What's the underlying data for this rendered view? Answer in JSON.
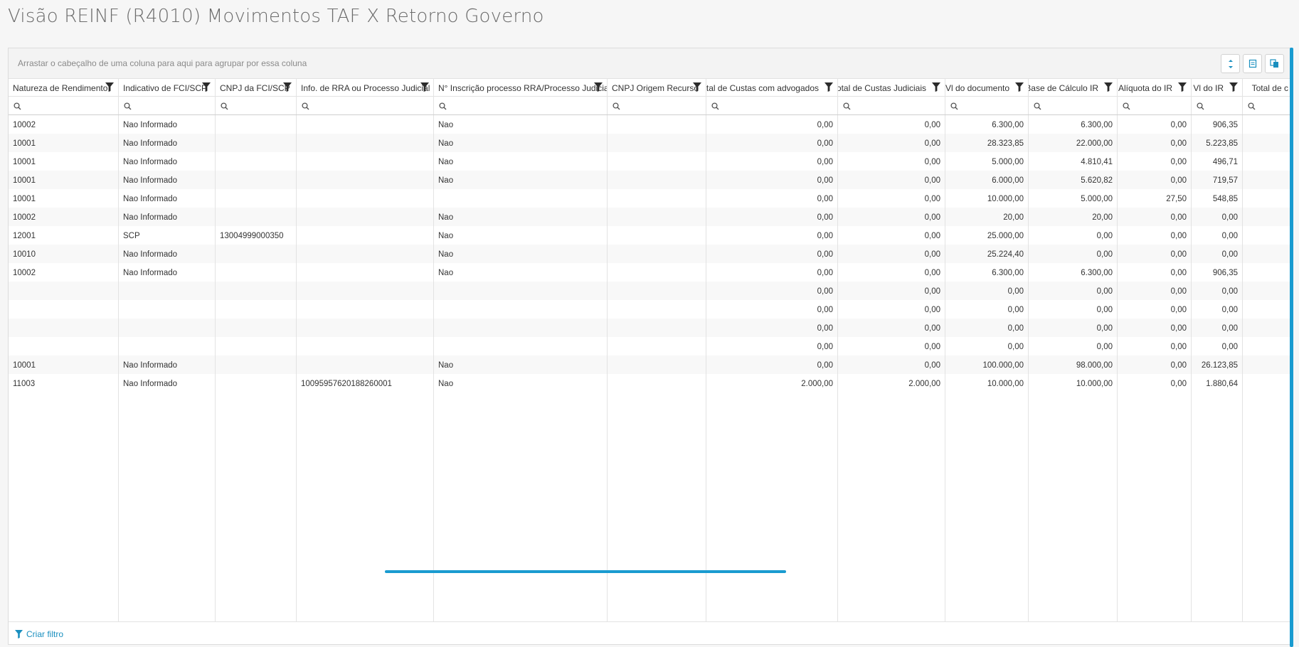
{
  "page": {
    "title": "Visão REINF (R4010) Movimentos TAF X Retorno Governo"
  },
  "groupbar": {
    "text": "Arrastar o cabeçalho de uma coluna para aqui para agrupar por essa coluna"
  },
  "toolbar": {
    "buttons": [
      {
        "icon": "column-chooser-icon"
      },
      {
        "icon": "export-icon"
      },
      {
        "icon": "copy-icon"
      }
    ]
  },
  "columns": [
    {
      "label": "Natureza de Rendimento",
      "align": "left"
    },
    {
      "label": "Indicativo de FCI/SCP",
      "align": "left"
    },
    {
      "label": "CNPJ da FCI/SCP",
      "align": "left"
    },
    {
      "label": "Info. de RRA ou Processo Judicial",
      "align": "left"
    },
    {
      "label": "N° Inscrição processo RRA/Processo Judicial",
      "align": "left"
    },
    {
      "label": "CNPJ Origem Recurso",
      "align": "left"
    },
    {
      "label": "Total de Custas com advogados",
      "align": "right"
    },
    {
      "label": "Total de Custas Judiciais",
      "align": "right"
    },
    {
      "label": "Vl do documento",
      "align": "right"
    },
    {
      "label": "Base de Cálculo IR",
      "align": "right"
    },
    {
      "label": "Alíquota do IR",
      "align": "right"
    },
    {
      "label": "Vl do IR",
      "align": "right"
    },
    {
      "label": "Total de c",
      "align": "right"
    }
  ],
  "rows": [
    [
      "10002",
      "Nao Informado",
      "",
      "",
      "Nao",
      "",
      "0,00",
      "0,00",
      "6.300,00",
      "6.300,00",
      "0,00",
      "906,35",
      ""
    ],
    [
      "10001",
      "Nao Informado",
      "",
      "",
      "Nao",
      "",
      "0,00",
      "0,00",
      "28.323,85",
      "22.000,00",
      "0,00",
      "5.223,85",
      ""
    ],
    [
      "10001",
      "Nao Informado",
      "",
      "",
      "Nao",
      "",
      "0,00",
      "0,00",
      "5.000,00",
      "4.810,41",
      "0,00",
      "496,71",
      ""
    ],
    [
      "10001",
      "Nao Informado",
      "",
      "",
      "Nao",
      "",
      "0,00",
      "0,00",
      "6.000,00",
      "5.620,82",
      "0,00",
      "719,57",
      ""
    ],
    [
      "10001",
      "Nao Informado",
      "",
      "",
      "",
      "",
      "0,00",
      "0,00",
      "10.000,00",
      "5.000,00",
      "27,50",
      "548,85",
      ""
    ],
    [
      "10002",
      "Nao Informado",
      "",
      "",
      "Nao",
      "",
      "0,00",
      "0,00",
      "20,00",
      "20,00",
      "0,00",
      "0,00",
      ""
    ],
    [
      "12001",
      "SCP",
      "13004999000350",
      "",
      "Nao",
      "",
      "0,00",
      "0,00",
      "25.000,00",
      "0,00",
      "0,00",
      "0,00",
      ""
    ],
    [
      "10010",
      "Nao Informado",
      "",
      "",
      "Nao",
      "",
      "0,00",
      "0,00",
      "25.224,40",
      "0,00",
      "0,00",
      "0,00",
      ""
    ],
    [
      "10002",
      "Nao Informado",
      "",
      "",
      "Nao",
      "",
      "0,00",
      "0,00",
      "6.300,00",
      "6.300,00",
      "0,00",
      "906,35",
      ""
    ],
    [
      "",
      "",
      "",
      "",
      "",
      "",
      "0,00",
      "0,00",
      "0,00",
      "0,00",
      "0,00",
      "0,00",
      ""
    ],
    [
      "",
      "",
      "",
      "",
      "",
      "",
      "0,00",
      "0,00",
      "0,00",
      "0,00",
      "0,00",
      "0,00",
      ""
    ],
    [
      "",
      "",
      "",
      "",
      "",
      "",
      "0,00",
      "0,00",
      "0,00",
      "0,00",
      "0,00",
      "0,00",
      ""
    ],
    [
      "",
      "",
      "",
      "",
      "",
      "",
      "0,00",
      "0,00",
      "0,00",
      "0,00",
      "0,00",
      "0,00",
      ""
    ],
    [
      "10001",
      "Nao Informado",
      "",
      "",
      "Nao",
      "",
      "0,00",
      "0,00",
      "100.000,00",
      "98.000,00",
      "0,00",
      "26.123,85",
      ""
    ],
    [
      "11003",
      "Nao Informado",
      "",
      "10095957620188260001",
      "Nao",
      "",
      "2.000,00",
      "2.000,00",
      "10.000,00",
      "10.000,00",
      "0,00",
      "1.880,64",
      ""
    ]
  ],
  "footer": {
    "create_filter_label": "Criar filtro"
  },
  "colors": {
    "accent": "#1a9bd0",
    "title": "#6b6b6b"
  }
}
